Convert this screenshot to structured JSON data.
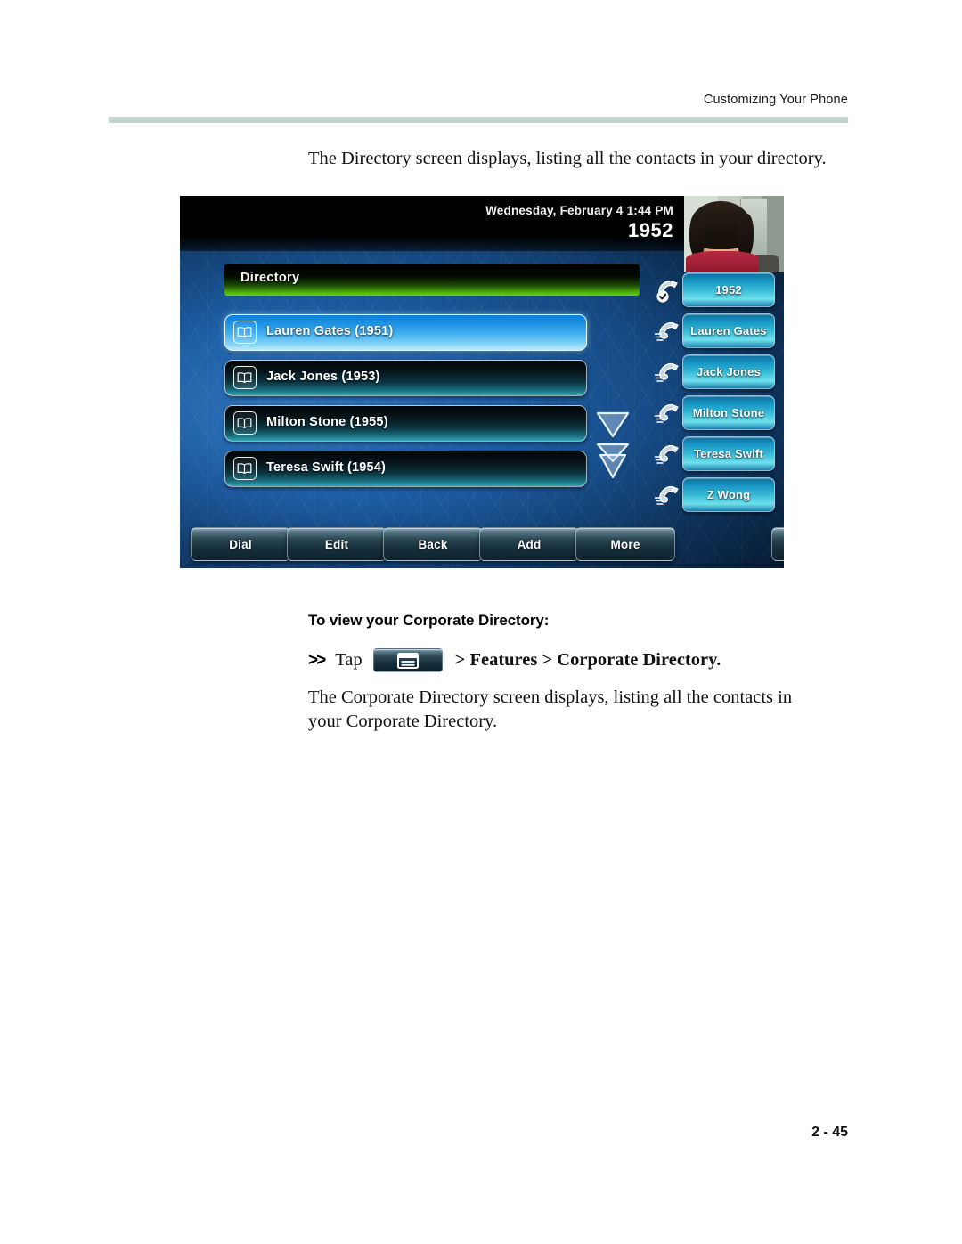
{
  "header": {
    "running_head": "Customizing Your Phone"
  },
  "intro": {
    "text": "The Directory screen displays, listing all the contacts in your directory."
  },
  "phone": {
    "status_bar": {
      "datetime": "Wednesday, February 4  1:44 PM",
      "extension": "1952"
    },
    "avatar": {
      "icon": "user-photo"
    },
    "title_bar": {
      "title": "Directory"
    },
    "contacts": [
      {
        "icon": "directory-book-icon",
        "label": "Lauren Gates (1951)",
        "selected": true
      },
      {
        "icon": "directory-book-icon",
        "label": "Jack Jones (1953)",
        "selected": false
      },
      {
        "icon": "directory-book-icon",
        "label": "Milton Stone (1955)",
        "selected": false
      },
      {
        "icon": "directory-book-icon",
        "label": "Teresa Swift (1954)",
        "selected": false
      }
    ],
    "scroll": {
      "single_arrow_icon": "chevron-down-icon",
      "double_arrow_icon": "chevron-double-down-icon"
    },
    "line_keys": [
      {
        "label": "1952",
        "icon": "handset-registered-icon"
      },
      {
        "label": "Lauren Gates",
        "icon": "handset-icon"
      },
      {
        "label": "Jack Jones",
        "icon": "handset-icon"
      },
      {
        "label": "Milton Stone",
        "icon": "handset-icon"
      },
      {
        "label": "Teresa Swift",
        "icon": "handset-icon"
      },
      {
        "label": "Z Wong",
        "icon": "handset-icon"
      }
    ],
    "soft_keys": [
      {
        "label": "Dial"
      },
      {
        "label": "Edit"
      },
      {
        "label": "Back"
      },
      {
        "label": "Add"
      },
      {
        "label": "More"
      }
    ],
    "home_key": {
      "icon": "home-icon"
    }
  },
  "section": {
    "subhead": "To view your Corporate Directory:",
    "tap_marker": ">>",
    "tap_word": "Tap",
    "menu_key_icon": "menu-window-icon",
    "menu_path": "> Features > Corporate Directory.",
    "closing_paragraph": "The Corporate Directory screen displays, listing all the contacts in your Corporate Directory."
  },
  "footer": {
    "page_number": "2 - 45"
  },
  "colors": {
    "header_rule": "#c2d3cd",
    "title_bar_green": "#63d40d",
    "selected_row_blue": "#46b2ef",
    "line_key_cyan": "#39bcd8"
  }
}
